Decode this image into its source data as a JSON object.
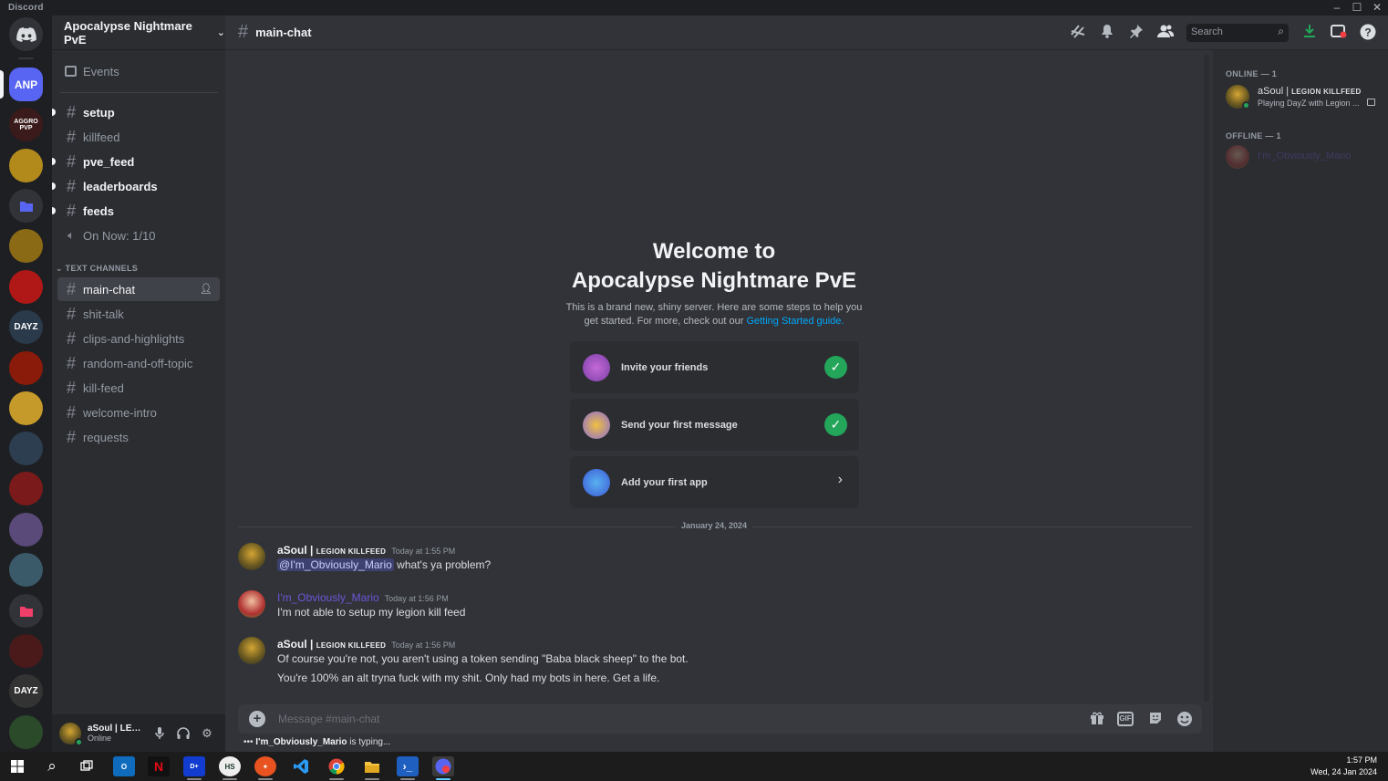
{
  "window": {
    "app_name": "Discord",
    "controls": [
      "–",
      "☐",
      "✕"
    ]
  },
  "rail": {
    "home_icon": "discord-logo-icon",
    "servers": [
      {
        "label": "ANP",
        "bg": "#5865f2",
        "active": true
      },
      {
        "label": "AGGRO PVP",
        "bg": "#3a1a1a"
      },
      {
        "label": "",
        "bg": "#b28a1c"
      },
      {
        "label": "",
        "bg": "#5865f2",
        "folder": true
      },
      {
        "label": "",
        "bg": "#8a6a14"
      },
      {
        "label": "",
        "bg": "#b01818"
      },
      {
        "label": "DAYZ",
        "bg": "#2a3a4a"
      },
      {
        "label": "",
        "bg": "#8a1a0a"
      },
      {
        "label": "",
        "bg": "#c59a2a"
      },
      {
        "label": "",
        "bg": "#2c3e50"
      },
      {
        "label": "",
        "bg": "#7a1a1a"
      },
      {
        "label": "",
        "bg": "#5a4a7a"
      },
      {
        "label": "",
        "bg": "#3a5a6a"
      },
      {
        "label": "",
        "bg": "#f23f6a",
        "folder": true
      },
      {
        "label": "",
        "bg": "#4a1a1a"
      },
      {
        "label": "DAYZ",
        "bg": "#333"
      },
      {
        "label": "",
        "bg": "#2a4a2a"
      }
    ]
  },
  "sidebar": {
    "server_name": "Apocalypse Nightmare PvE",
    "events_label": "Events",
    "channels_top": [
      {
        "name": "setup",
        "unread": true,
        "type": "text"
      },
      {
        "name": "killfeed",
        "unread": false,
        "type": "text"
      },
      {
        "name": "pve_feed",
        "unread": true,
        "type": "text"
      },
      {
        "name": "leaderboards",
        "unread": true,
        "type": "text"
      },
      {
        "name": "feeds",
        "unread": true,
        "type": "text"
      },
      {
        "name": "On Now: 1/10",
        "unread": false,
        "type": "voice"
      }
    ],
    "category": "TEXT CHANNELS",
    "channels": [
      {
        "name": "main-chat",
        "active": true
      },
      {
        "name": "shit-talk"
      },
      {
        "name": "clips-and-highlights"
      },
      {
        "name": "random-and-off-topic"
      },
      {
        "name": "kill-feed"
      },
      {
        "name": "welcome-intro"
      },
      {
        "name": "requests"
      }
    ]
  },
  "user_panel": {
    "name": "aSoul | LEGI...",
    "status": "Online"
  },
  "header": {
    "channel": "main-chat",
    "search_placeholder": "Search"
  },
  "welcome": {
    "line1": "Welcome to",
    "line2": "Apocalypse Nightmare PvE",
    "desc": "This is a brand new, shiny server. Here are some steps to help you get started. For more, check out our",
    "link": "Getting Started guide.",
    "cards": [
      {
        "label": "Invite your friends",
        "done": true,
        "icon": "invite-friends-icon"
      },
      {
        "label": "Send your first message",
        "done": true,
        "icon": "send-message-icon"
      },
      {
        "label": "Add your first app",
        "done": false,
        "icon": "add-app-icon"
      }
    ]
  },
  "date_divider": "January 24, 2024",
  "messages": [
    {
      "author_main": "aSoul | ",
      "author_tag": "LEGION KILLFEED",
      "time": "Today at 1:55 PM",
      "mention": "@I'm_Obviously_Mario",
      "lines": [
        " what's ya problem?"
      ]
    },
    {
      "author_main": "I'm_Obviously_Mario",
      "author_tag": "",
      "time": "Today at 1:56 PM",
      "mention": "",
      "lines": [
        "I'm not able to setup my legion kill feed"
      ]
    },
    {
      "author_main": "aSoul | ",
      "author_tag": "LEGION KILLFEED",
      "time": "Today at 1:56 PM",
      "mention": "",
      "lines": [
        "Of course you're not, you aren't using a token sending \"Baba black sheep\" to the bot.",
        "You're 100% an alt tryna fuck with my shit. Only had my bots in here. Get a life."
      ]
    }
  ],
  "composer": {
    "placeholder": "Message #main-chat",
    "gif_label": "GIF"
  },
  "typing": {
    "user": "I'm_Obviously_Mario",
    "suffix": " is typing..."
  },
  "members": {
    "online_header": "ONLINE — 1",
    "offline_header": "OFFLINE — 1",
    "online": [
      {
        "name_main": "aSoul | ",
        "name_tag": "LEGION KILLFEED",
        "activity": "Playing DayZ with Legion ..."
      }
    ],
    "offline": [
      {
        "name": "I'm_Obviously_Mario"
      }
    ]
  },
  "taskbar": {
    "time": "1:57 PM",
    "date": "Wed, 24 Jan 2024"
  },
  "colors": {
    "accent": "#5865f2",
    "online": "#23a55a",
    "link": "#00a8fc",
    "mario": "#6c56d8"
  }
}
